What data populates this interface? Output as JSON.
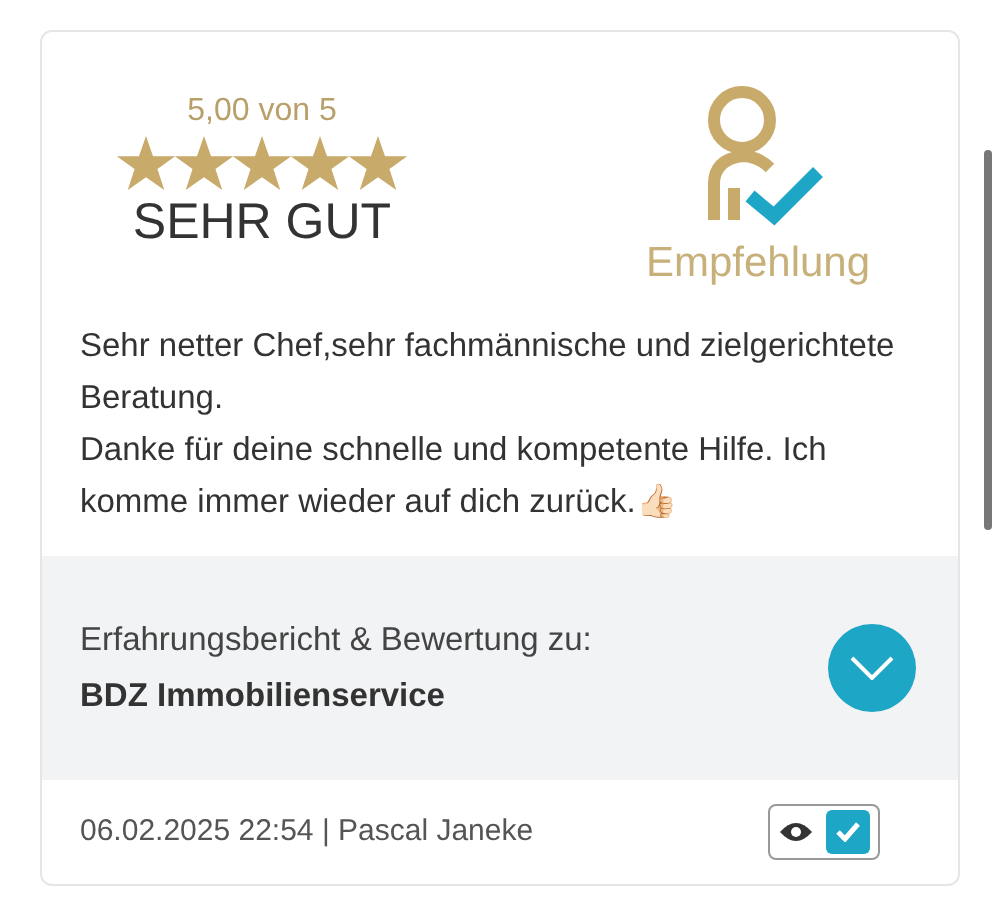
{
  "rating": {
    "score": "5,00 von 5",
    "stars": 5,
    "verdict": "SEHR GUT"
  },
  "recommendation": {
    "label": "Empfehlung"
  },
  "review": {
    "text": "Sehr netter Chef,sehr fachmännische und zielgerichtete Beratung.\nDanke für deine schnelle und kompetente Hilfe. Ich komme immer wieder auf dich zurück.👍🏻"
  },
  "subject": {
    "intro": "Erfahrungsbericht & Bewertung zu:",
    "name": "BDZ Immobilienservice",
    "expanded": false
  },
  "footer": {
    "meta": "06.02.2025 22:54 | Pascal Janeke",
    "checked": true
  }
}
